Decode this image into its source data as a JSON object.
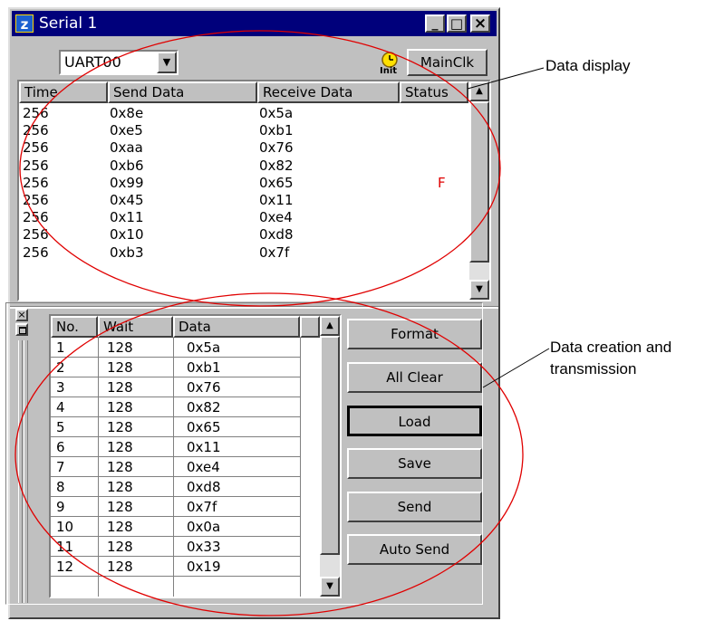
{
  "window": {
    "title": "Serial 1",
    "app_icon_letter": "z",
    "controls": {
      "minimize": "_",
      "maximize": "□",
      "close": "×"
    }
  },
  "toolbar": {
    "port_select_value": "UART00",
    "dropdown_arrow": "▼",
    "clock_icon_label": "Init",
    "mainclk_label": "MainClk"
  },
  "data_display": {
    "columns": [
      "Time",
      "Send Data",
      "Receive Data",
      "Status"
    ],
    "rows": [
      {
        "time": "256",
        "send": "0x8e",
        "receive": "0x5a",
        "status": ""
      },
      {
        "time": "256",
        "send": "0xe5",
        "receive": "0xb1",
        "status": ""
      },
      {
        "time": "256",
        "send": "0xaa",
        "receive": "0x76",
        "status": ""
      },
      {
        "time": "256",
        "send": "0xb6",
        "receive": "0x82",
        "status": ""
      },
      {
        "time": "256",
        "send": "0x99",
        "receive": "0x65",
        "status": "F"
      },
      {
        "time": "256",
        "send": "0x45",
        "receive": "0x11",
        "status": ""
      },
      {
        "time": "256",
        "send": "0x11",
        "receive": "0xe4",
        "status": ""
      },
      {
        "time": "256",
        "send": "0x10",
        "receive": "0xd8",
        "status": ""
      },
      {
        "time": "256",
        "send": "0xb3",
        "receive": "0x7f",
        "status": ""
      }
    ],
    "scroll_up": "▲",
    "scroll_down": "▼",
    "status_color": "#e00000"
  },
  "creation_pane": {
    "close_glyph": "×",
    "columns": [
      "No.",
      "Wait",
      "Data"
    ],
    "rows": [
      {
        "no": "1",
        "wait": "128",
        "data": "0x5a"
      },
      {
        "no": "2",
        "wait": "128",
        "data": "0xb1"
      },
      {
        "no": "3",
        "wait": "128",
        "data": "0x76"
      },
      {
        "no": "4",
        "wait": "128",
        "data": "0x82"
      },
      {
        "no": "5",
        "wait": "128",
        "data": "0x65"
      },
      {
        "no": "6",
        "wait": "128",
        "data": "0x11"
      },
      {
        "no": "7",
        "wait": "128",
        "data": "0xe4"
      },
      {
        "no": "8",
        "wait": "128",
        "data": "0xd8"
      },
      {
        "no": "9",
        "wait": "128",
        "data": "0x7f"
      },
      {
        "no": "10",
        "wait": "128",
        "data": "0x0a"
      },
      {
        "no": "11",
        "wait": "128",
        "data": "0x33"
      },
      {
        "no": "12",
        "wait": "128",
        "data": "0x19"
      }
    ],
    "scroll_up": "▲",
    "scroll_down": "▼",
    "buttons": {
      "format": "Format",
      "all_clear": "All Clear",
      "load": "Load",
      "save": "Save",
      "send": "Send",
      "auto_send": "Auto Send"
    }
  },
  "annotations": {
    "data_display": "Data display",
    "creation_line1": "Data creation and",
    "creation_line2": "transmission",
    "ellipse_color": "#e00000"
  }
}
